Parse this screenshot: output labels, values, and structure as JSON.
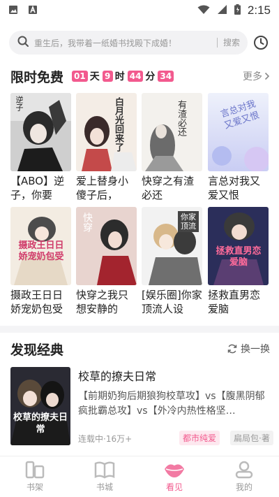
{
  "status": {
    "time": "2:15"
  },
  "search": {
    "placeholder": "重生后，我带着一纸婚书找殿下成婚！",
    "button": "搜索"
  },
  "free_section": {
    "title": "限时免费",
    "countdown": {
      "days": "01",
      "day_unit": "天",
      "hours": "9",
      "hour_unit": "时",
      "minutes": "44",
      "minute_unit": "分",
      "seconds": "34"
    },
    "more": "更多",
    "books": [
      {
        "title": "【ABO】逆子，你要以…",
        "cover_text": "逆子"
      },
      {
        "title": "爱上替身小傻子后，白…",
        "cover_text": "白月光回来了"
      },
      {
        "title": "快穿之有渣必还",
        "cover_text": "有渣必还"
      },
      {
        "title": "言总对我又爱又恨",
        "cover_text": "言总对我又爱又恨"
      },
      {
        "title": "摄政王日日娇宠奶包受",
        "cover_text": "摄政王日日娇宠奶包受"
      },
      {
        "title": "快穿之我只想安静的作…",
        "cover_text": "快穿"
      },
      {
        "title": "[娱乐圈]你家顶流人设又…",
        "cover_text": "你家顶流"
      },
      {
        "title": "拯救直男恋爱脑",
        "cover_text": "拯救直男恋爱脑"
      }
    ]
  },
  "discover_section": {
    "title": "发现经典",
    "swap": "换一换",
    "featured": {
      "title": "校草的撩夫日常",
      "description": "【前期奶狗后期狼狗校草攻】vs【腹黑阴郁疯批霸总攻】vs【外冷内热性格坚…",
      "meta": "连载中·16万+",
      "tags": [
        "都市纯爱",
        "扁局包·著"
      ],
      "cover_text": "校草的撩夫日常"
    }
  },
  "tabs": [
    {
      "label": "书架"
    },
    {
      "label": "书城"
    },
    {
      "label": "看见"
    },
    {
      "label": "我的"
    }
  ],
  "colors": {
    "accent": "#f25a8e"
  }
}
